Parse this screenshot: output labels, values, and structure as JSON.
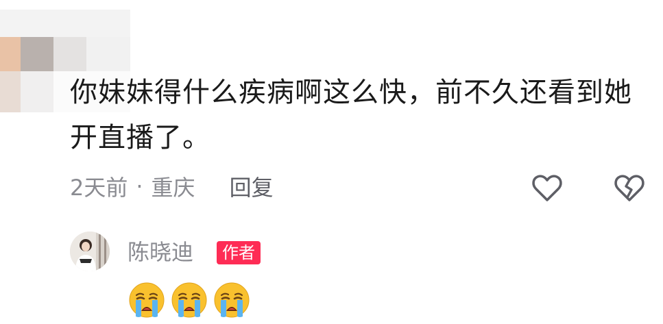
{
  "comment": {
    "text": "你妹妹得什么疾病啊这么快，前不久还看到她开直播了。",
    "time": "2天前",
    "separator": "·",
    "location": "重庆",
    "reply_label": "回复"
  },
  "icons": {
    "like": "heart-outline-icon",
    "dislike": "broken-heart-icon",
    "emoji": "loudly-crying-face-icon"
  },
  "author_reply": {
    "name": "陈晓迪",
    "badge": "作者",
    "emoji_count": 3
  },
  "colors": {
    "badge_bg": "#fe2c55",
    "meta_text": "#8a8b91",
    "body_text": "#1a1a1a"
  }
}
